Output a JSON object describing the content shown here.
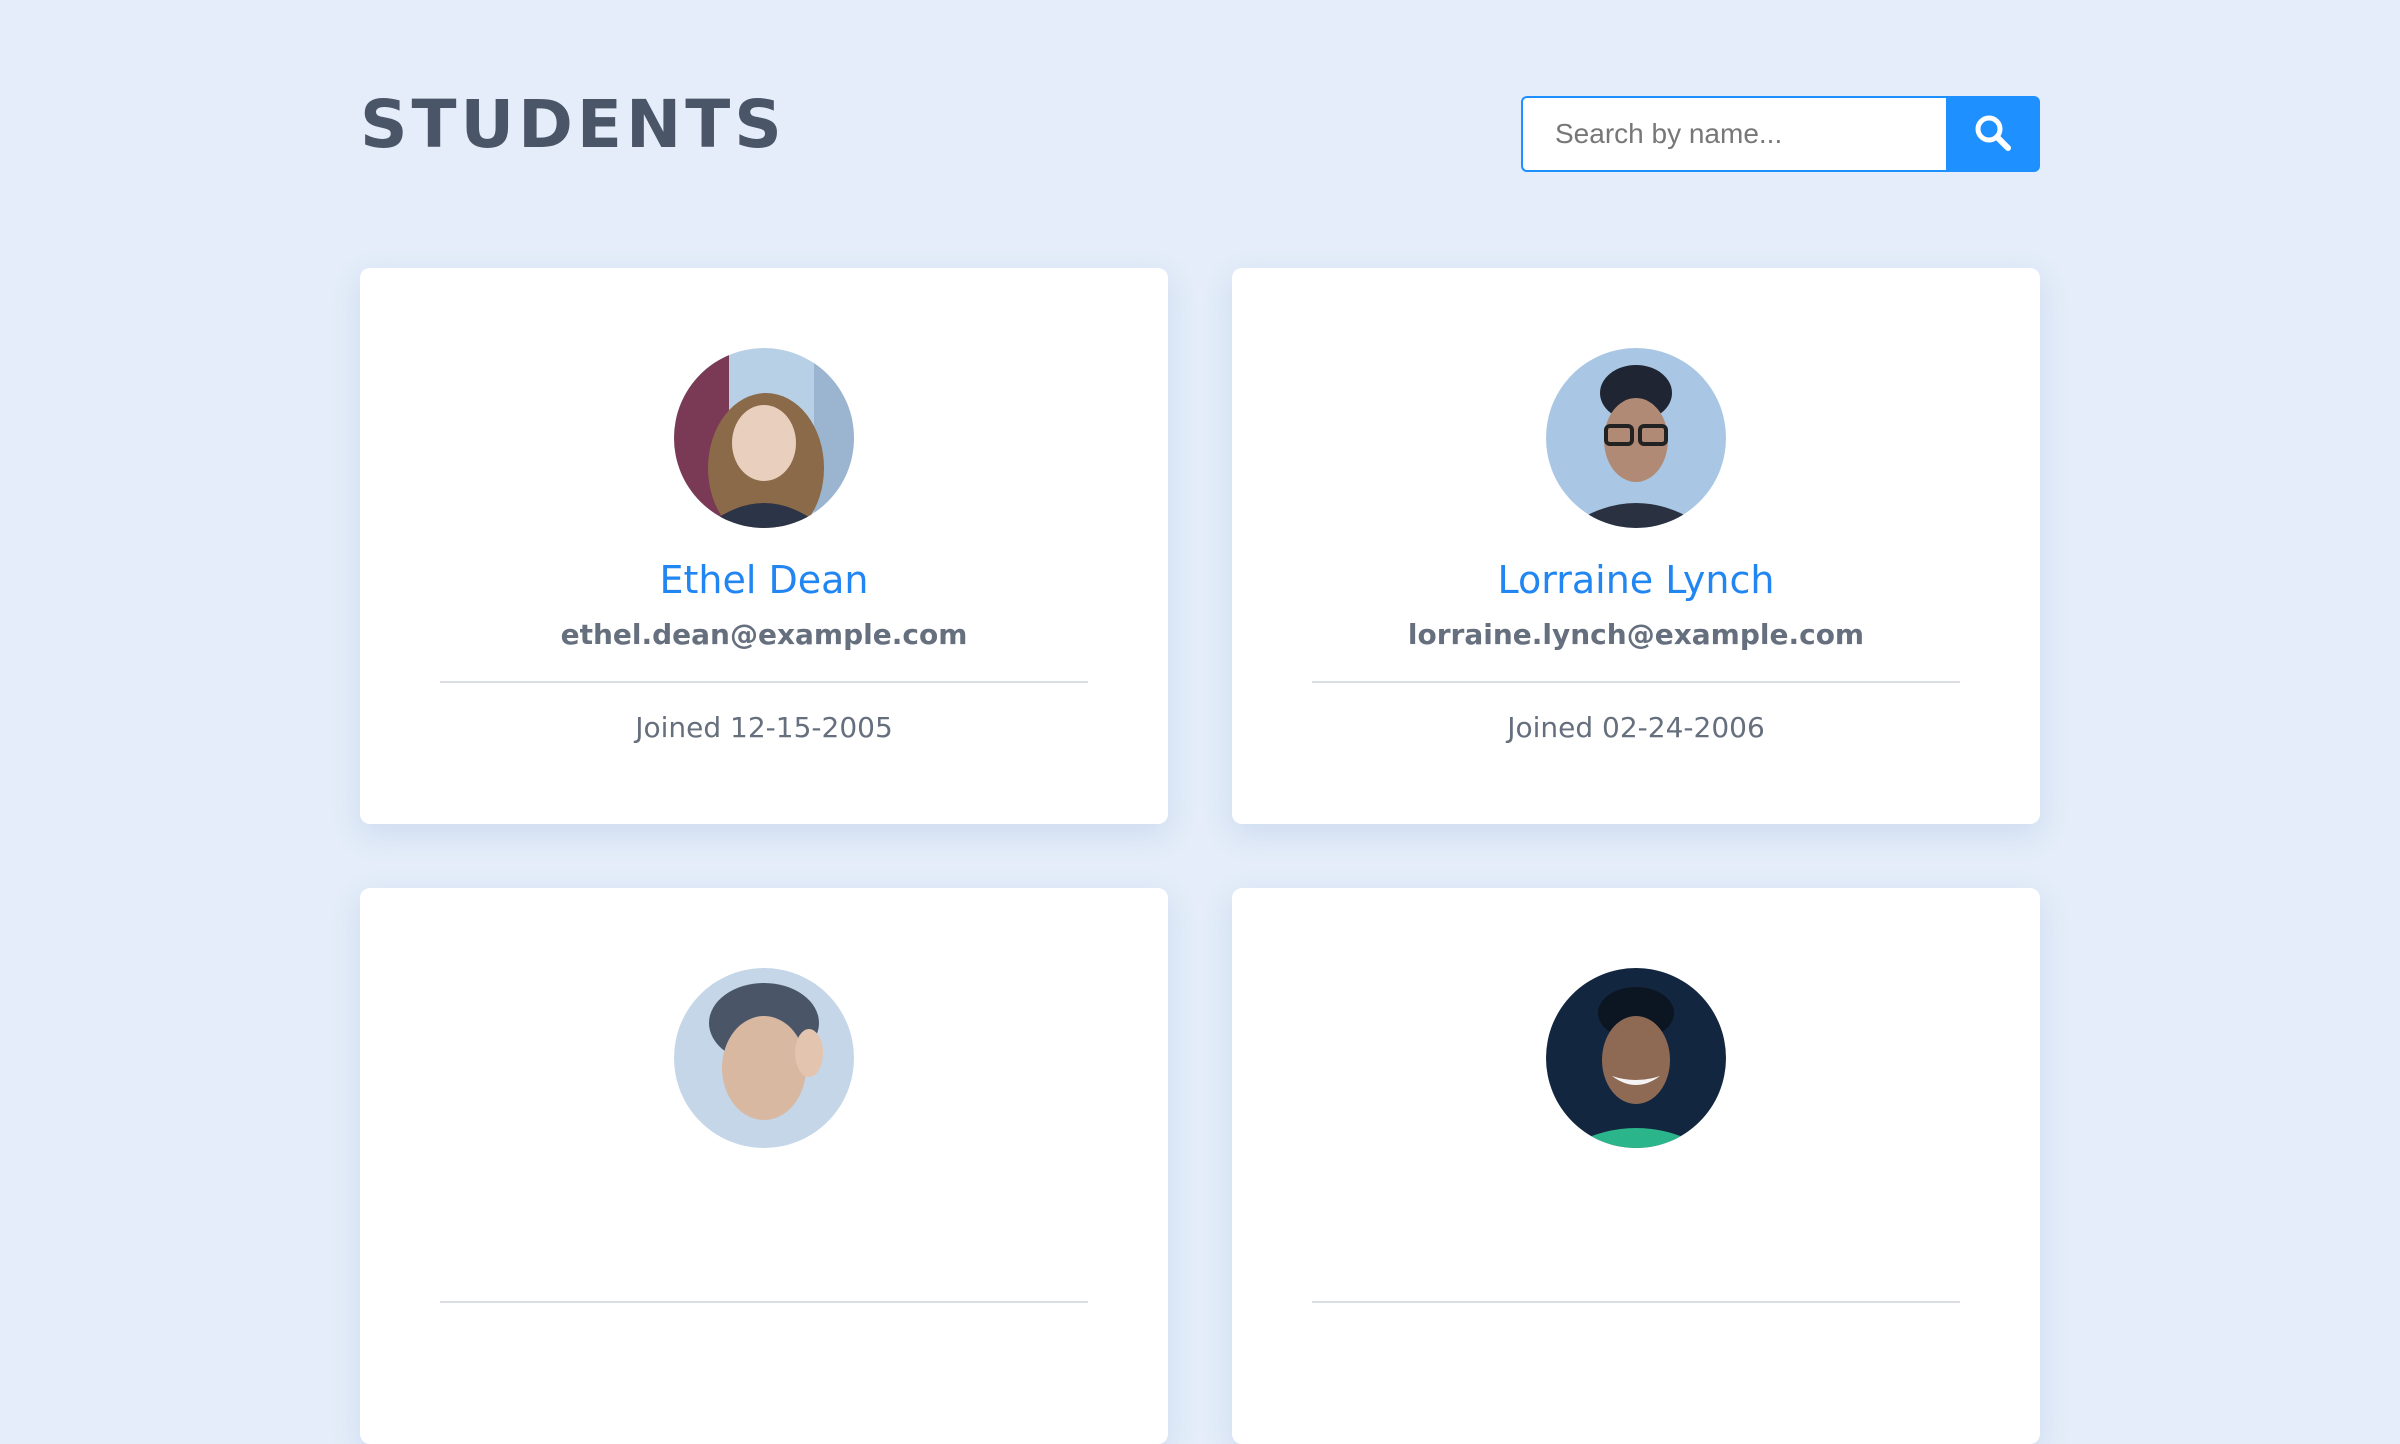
{
  "header": {
    "title": "STUDENTS"
  },
  "search": {
    "placeholder": "Search by name...",
    "value": "",
    "button_icon": "search-icon"
  },
  "students": [
    {
      "name": "Ethel Dean",
      "email": "ethel.dean@example.com",
      "joined": "Joined 12-15-2005"
    },
    {
      "name": "Lorraine Lynch",
      "email": "lorraine.lynch@example.com",
      "joined": "Joined 02-24-2006"
    },
    {
      "name": "",
      "email": "",
      "joined": ""
    },
    {
      "name": "",
      "email": "",
      "joined": ""
    }
  ],
  "colors": {
    "background": "#e4edf9",
    "accent": "#1e90ff",
    "name_text": "#2186f2",
    "title_text": "#4a5568",
    "muted_text": "#666f7d"
  }
}
